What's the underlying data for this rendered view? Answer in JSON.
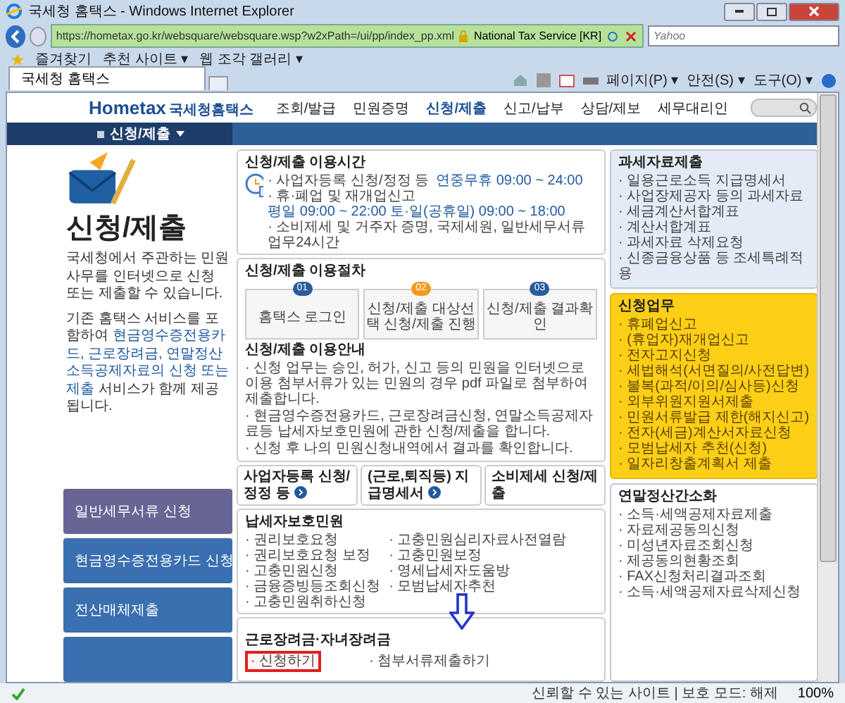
{
  "window": {
    "title": "국세청 홈택스 - Windows Internet Explorer"
  },
  "address_bar": {
    "url": "https://hometax.go.kr/websquare/websquare.wsp?w2xPath=/ui/pp/index_pp.xml",
    "certificate": "National Tax Service [KR]"
  },
  "search": {
    "placeholder": "Yahoo"
  },
  "favorites_bar": {
    "label": "즐겨찾기",
    "items": [
      "추천 사이트 ▾",
      "웹 조각 갤러리 ▾"
    ]
  },
  "tabs": [
    {
      "label": "국세청 홈택스",
      "selected": true
    }
  ],
  "command_bar": [
    "페이지(P) ▾",
    "안전(S) ▾",
    "도구(O) ▾"
  ],
  "header": {
    "logo": "Hometax",
    "logo_text": "국세청홈택스",
    "nav": [
      {
        "label": "조회/발급",
        "selected": false
      },
      {
        "label": "민원증명",
        "selected": false
      },
      {
        "label": "신청/제출",
        "selected": true
      },
      {
        "label": "신고/납부",
        "selected": false
      },
      {
        "label": "상담/제보",
        "selected": false
      },
      {
        "label": "세무대리인",
        "selected": false
      }
    ],
    "breadcrumb": "신청/제출"
  },
  "intro": {
    "title": "신청/제출",
    "text": "국세청에서 주관하는 민원사무를 인터넷으로 신청 또는 제출할 수 있습니다.",
    "text2_before": "기존 홈택스 서비스를 포함하여",
    "text2_highlight": "현금영수증전용카드, 근로장려금, 연말정산소득공제자료의 신청 또는 제출",
    "text2_after": "서비스가 함께 제공됩니다."
  },
  "side_menu": [
    {
      "label": "일반세무서류 신청",
      "selected": true
    },
    {
      "label": "현금영수증전용카드 신청",
      "selected": false
    },
    {
      "label": "전산매체제출",
      "selected": false
    },
    {
      "selected": false
    }
  ],
  "hours": {
    "title": "신청/제출 이용시간",
    "rows": [
      {
        "label": "· 사업자등록 신청/정정 등",
        "value": "연중무휴 09:00 ~ 24:00"
      },
      {
        "label": "· 휴·폐업 및 재개업신고",
        "value": "평일 09:00 ~ 22:00 토·일(공휴일) 09:00 ~ 18:00"
      },
      {
        "label": "· 소비제세 및 거주자 증명, 국제세원, 일반세무서류 업무24시간"
      }
    ]
  },
  "procedure": {
    "title": "신청/제출 이용절차",
    "steps": [
      {
        "number": "01",
        "label": "홈택스 로그인",
        "color": "#2a5b9c"
      },
      {
        "number": "02",
        "label": "신청/제출 대상선택 신청/제출 진행",
        "color": "#f39a1e"
      },
      {
        "number": "03",
        "label": "신청/제출 결과확인",
        "color": "#2a5b9c"
      }
    ]
  },
  "guide": {
    "title": "신청/제출 이용안내",
    "items": [
      "· 신청 업무는 승인, 허가, 신고 등의 민원을 인터넷으로 이용 첨부서류가 있는 민원의 경우 pdf 파일로 첨부하여 제출합니다.",
      "· 현금영수증전용카드, 근로장려금신청, 연말소득공제자료등 납세자보호민원에 관한 신청/제출을 합니다.",
      "· 신청 후 나의 민원신청내역에서 결과를 확인합니다."
    ]
  },
  "shortcuts": [
    {
      "label": "사업자등록 신청/정정 등",
      "arrow": true
    },
    {
      "label": "(근로,퇴직등) 지급명세서",
      "arrow": true
    },
    {
      "label": "소비제세 신청/제출",
      "arrow": false
    }
  ],
  "taxpayer_protection": {
    "title": "납세자보호민원",
    "column_1": [
      "· 권리보호요청",
      "· 권리보호요청 보정",
      "· 고충민원신청",
      "· 금융증빙등조회신청",
      "· 고충민원취하신청"
    ],
    "column_2": [
      "· 고충민원심리자료사전열람",
      "· 고충민원보정",
      "· 영세납세자도움방",
      "· 모범납세자추천"
    ]
  },
  "incentive": {
    "title": "근로장려금·자녀장려금",
    "items": [
      {
        "label": "· 신청하기",
        "highlighted": true
      },
      {
        "label": "· 첨부서류제출하기",
        "highlighted": false
      }
    ]
  },
  "right_panels": [
    {
      "kind": "plain",
      "title": "과세자료제출",
      "items": [
        "· 일용근로소득 지급명세서",
        "· 사업장제공자 등의 과세자료",
        "· 세금계산서합계표",
        "· 계산서합계표",
        "· 과세자료 삭제요청",
        "· 신종금융상품 등 조세특례적용"
      ]
    },
    {
      "kind": "highlight",
      "title": "신청업무",
      "items": [
        "· 휴폐업신고",
        "· (휴업자)재개업신고",
        "· 전자고지신청",
        "· 세법해석(서면질의/사전답변)",
        "· 불복(과적/이의/심사등)신청",
        "· 외부위원지원서제출",
        "· 민원서류발급 제한(해지신고)",
        "· 전자(세금)계산서자료신청",
        "· 모범납세자 추천(신청)",
        "· 일자리창출계획서 제출"
      ]
    },
    {
      "kind": "white",
      "title": "연말정산간소화",
      "items": [
        "· 소득·세액공제자료제출",
        "· 자료제공동의신청",
        "· 미성년자료조회신청",
        "· 제공동의현황조회",
        "· FAX신청처리결과조회",
        "· 소득·세액공제자료삭제신청"
      ]
    }
  ],
  "status_bar": {
    "text": "신뢰할 수 있는 사이트 | 보호 모드: 해제",
    "zoom": "100%"
  }
}
